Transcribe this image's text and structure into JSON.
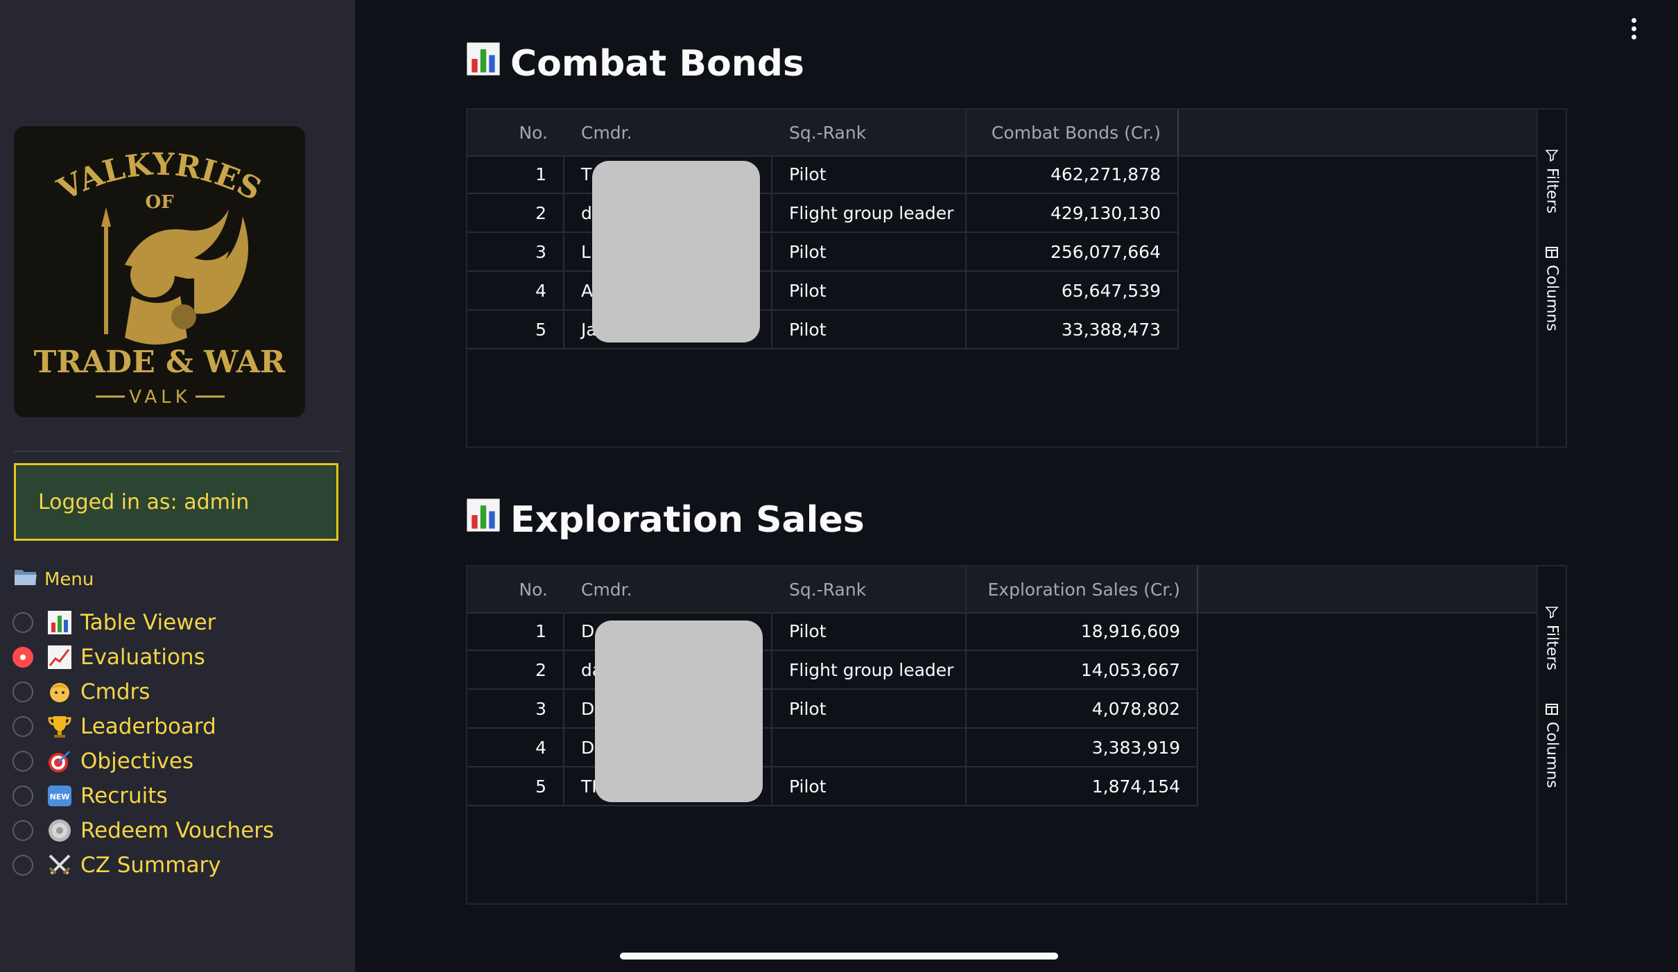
{
  "sidebar": {
    "logo": {
      "line1": "VALKYRIES",
      "line2": "OF",
      "line3": "TRADE & WAR",
      "line4": "VALK"
    },
    "login_text": "Logged in as: admin",
    "menu_title": "Menu",
    "menu_icon": "folder-icon",
    "items": [
      {
        "label": "Table Viewer",
        "icon": "bar-chart-icon",
        "selected": false
      },
      {
        "label": "Evaluations",
        "icon": "trending-chart-icon",
        "selected": true
      },
      {
        "label": "Cmdrs",
        "icon": "person-icon",
        "selected": false
      },
      {
        "label": "Leaderboard",
        "icon": "trophy-icon",
        "selected": false
      },
      {
        "label": "Objectives",
        "icon": "target-icon",
        "selected": false
      },
      {
        "label": "Recruits",
        "icon": "new-badge-icon",
        "selected": false
      },
      {
        "label": "Redeem Vouchers",
        "icon": "coin-icon",
        "selected": false
      },
      {
        "label": "CZ Summary",
        "icon": "crossed-swords-icon",
        "selected": false
      }
    ]
  },
  "colors": {
    "accent": "#f5d547",
    "selected_radio": "#ff4b4b",
    "background": "#0e1117",
    "sidebar": "#262730"
  },
  "sections": [
    {
      "title": "Combat Bonds",
      "icon": "bar-chart-icon",
      "columns": [
        "No.",
        "Cmdr.",
        "Sq.-Rank",
        "Combat Bonds (Cr.)"
      ],
      "rows": [
        {
          "no": "1",
          "cmdr": "T",
          "rank": "Pilot",
          "value": "462,271,878"
        },
        {
          "no": "2",
          "cmdr": "d",
          "rank": "Flight group leader",
          "value": "429,130,130"
        },
        {
          "no": "3",
          "cmdr": "L",
          "rank": "Pilot",
          "value": "256,077,664"
        },
        {
          "no": "4",
          "cmdr": "A",
          "rank": "Pilot",
          "value": "65,647,539"
        },
        {
          "no": "5",
          "cmdr": "Ja",
          "rank": "Pilot",
          "value": "33,388,473"
        }
      ],
      "toolbar": {
        "filters": "Filters",
        "columns": "Columns"
      }
    },
    {
      "title": "Exploration Sales",
      "icon": "bar-chart-icon",
      "columns": [
        "No.",
        "Cmdr.",
        "Sq.-Rank",
        "Exploration Sales (Cr.)"
      ],
      "rows": [
        {
          "no": "1",
          "cmdr": "D",
          "rank": "Pilot",
          "value": "18,916,609"
        },
        {
          "no": "2",
          "cmdr": "da",
          "rank": "Flight group leader",
          "value": "14,053,667"
        },
        {
          "no": "3",
          "cmdr": "D",
          "rank": "Pilot",
          "value": "4,078,802"
        },
        {
          "no": "4",
          "cmdr": "D",
          "rank": "",
          "value": "3,383,919"
        },
        {
          "no": "5",
          "cmdr": "TI",
          "rank": "Pilot",
          "value": "1,874,154"
        }
      ],
      "toolbar": {
        "filters": "Filters",
        "columns": "Columns"
      }
    }
  ]
}
